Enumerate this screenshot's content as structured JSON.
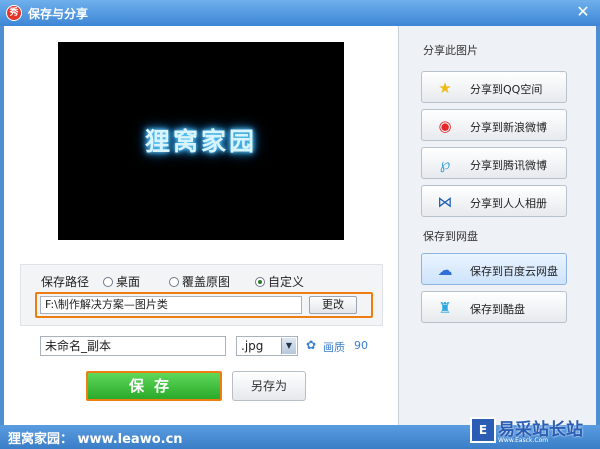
{
  "window": {
    "title": "保存与分享",
    "app_icon": "秀",
    "close": "✕"
  },
  "preview": {
    "text": "狸窝家园"
  },
  "save_path": {
    "label": "保存路径",
    "options": [
      {
        "label": "桌面",
        "selected": false
      },
      {
        "label": "覆盖原图",
        "selected": false
      },
      {
        "label": "自定义",
        "selected": true
      }
    ],
    "path_value": "F:\\制作解决方案—图片类",
    "change_label": "更改"
  },
  "file": {
    "name": "未命名_副本",
    "format": ".jpg",
    "format_arrow": "▼",
    "quality_icon": "✿",
    "quality_label": "画质",
    "quality_value": "90"
  },
  "actions": {
    "save_label": "保存",
    "save_as_label": "另存为"
  },
  "share": {
    "title": "分享此图片",
    "buttons": [
      {
        "label": "分享到QQ空间",
        "icon": "★",
        "icon_name": "qzone-star-icon",
        "color": "#f2b816"
      },
      {
        "label": "分享到新浪微博",
        "icon": "◉",
        "icon_name": "sina-weibo-icon",
        "color": "#e4282a"
      },
      {
        "label": "分享到腾讯微博",
        "icon": "℘",
        "icon_name": "tencent-weibo-icon",
        "color": "#3b9fd8"
      },
      {
        "label": "分享到人人相册",
        "icon": "⋈",
        "icon_name": "renren-icon",
        "color": "#1d5fb2"
      }
    ]
  },
  "cloud": {
    "title": "保存到网盘",
    "buttons": [
      {
        "label": "保存到百度云网盘",
        "icon": "☁",
        "icon_name": "baidu-cloud-icon",
        "color": "#2f6fd6"
      },
      {
        "label": "保存到酷盘",
        "icon": "♜",
        "icon_name": "kupan-icon",
        "color": "#2fa8e0"
      }
    ]
  },
  "footer": {
    "text": "狸窝家园： www.leawo.cn",
    "watermark_badge": "E",
    "watermark_text": "易采站长站",
    "watermark_sub": "Www.Easck.Com"
  }
}
